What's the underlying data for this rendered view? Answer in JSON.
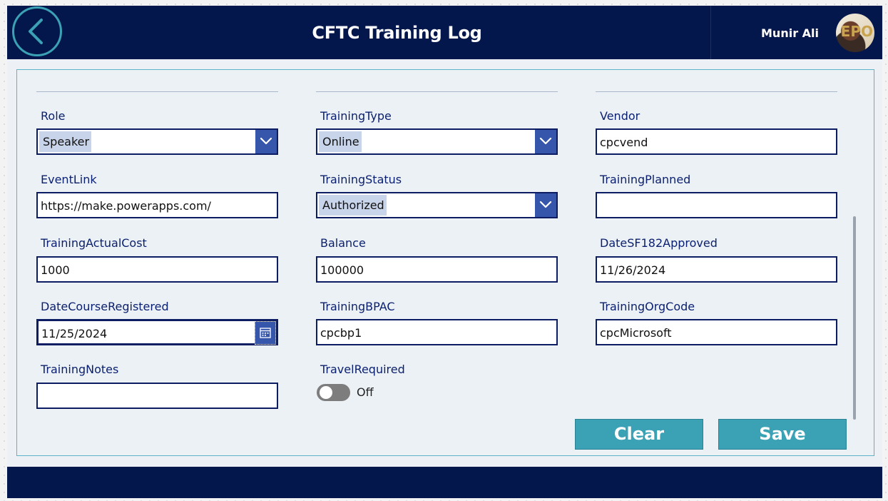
{
  "header": {
    "title": "CFTC Training Log",
    "user_name": "Munir Ali",
    "avatar_text": "EPO"
  },
  "colors": {
    "header_bg": "#04174c",
    "accent": "#3ba1b5",
    "field_border": "#0d1d63",
    "dropdown_bg": "#3656ac",
    "label": "#0a1f6e",
    "form_bg": "#ecf1f6"
  },
  "icons": {
    "back": "chevron-left-icon",
    "dropdown": "chevron-down-icon",
    "calendar": "calendar-icon"
  },
  "fields": {
    "role": {
      "label": "Role",
      "value": "Speaker"
    },
    "training_type": {
      "label": "TrainingType",
      "value": "Online"
    },
    "vendor": {
      "label": "Vendor",
      "value": "cpcvend"
    },
    "event_link": {
      "label": "EventLink",
      "value": "https://make.powerapps.com/"
    },
    "training_status": {
      "label": "TrainingStatus",
      "value": "Authorized"
    },
    "training_planned": {
      "label": "TrainingPlanned",
      "value": ""
    },
    "training_actual_cost": {
      "label": "TrainingActualCost",
      "value": "1000"
    },
    "balance": {
      "label": "Balance",
      "value": "100000"
    },
    "date_sf182_approved": {
      "label": "DateSF182Approved",
      "value": "11/26/2024"
    },
    "date_course_registered": {
      "label": "DateCourseRegistered",
      "value": "11/25/2024"
    },
    "training_bpac": {
      "label": "TrainingBPAC",
      "value": "cpcbp1"
    },
    "training_org_code": {
      "label": "TrainingOrgCode",
      "value": "cpcMicrosoft"
    },
    "training_notes": {
      "label": "TrainingNotes",
      "value": ""
    },
    "travel_required": {
      "label": "TravelRequired",
      "state": "Off"
    }
  },
  "buttons": {
    "clear": "Clear",
    "save": "Save"
  }
}
